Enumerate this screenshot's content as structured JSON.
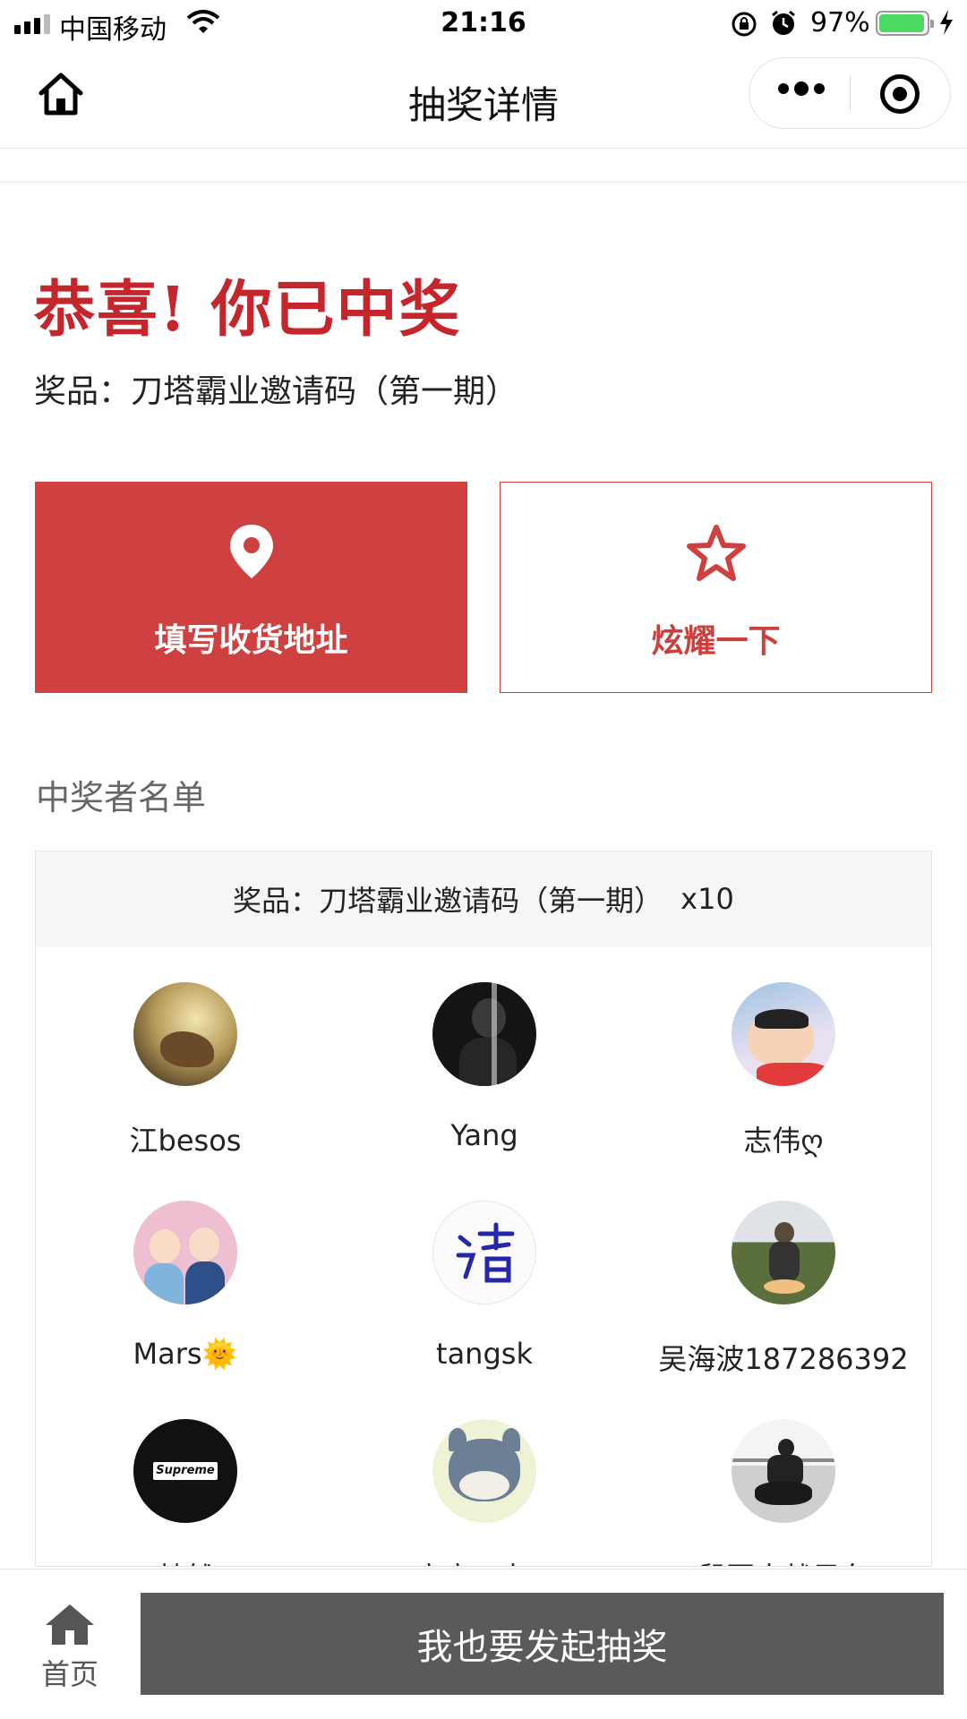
{
  "status_bar": {
    "carrier": "中国移动",
    "time": "21:16",
    "battery_pct": "97%",
    "battery_level": 0.97
  },
  "nav": {
    "title": "抽奖详情"
  },
  "result": {
    "headline": "恭喜! 你已中奖",
    "prize": "奖品：刀塔霸业邀请码（第一期）"
  },
  "actions": {
    "address_label": "填写收货地址",
    "show_off_label": "炫耀一下"
  },
  "winners": {
    "section_title": "中奖者名单",
    "prize": "奖品：刀塔霸业邀请码（第一期）",
    "quantity": "x10",
    "list": [
      {
        "name": "江besos"
      },
      {
        "name": "Yang"
      },
      {
        "name": "志伟ღ"
      },
      {
        "name": "Mars🌞"
      },
      {
        "name": "tangsk"
      },
      {
        "name": "吴海波187286392"
      },
      {
        "name": "梦然"
      },
      {
        "name": "瘪瘪一中三"
      },
      {
        "name": "鼠哥大战风车"
      }
    ]
  },
  "bottom_bar": {
    "home_label": "首页",
    "launch_label": "我也要发起抽奖"
  },
  "colors": {
    "accent_red": "#cf4140",
    "headline_red": "#c5262b",
    "launch_button": "#5a5a5a"
  }
}
